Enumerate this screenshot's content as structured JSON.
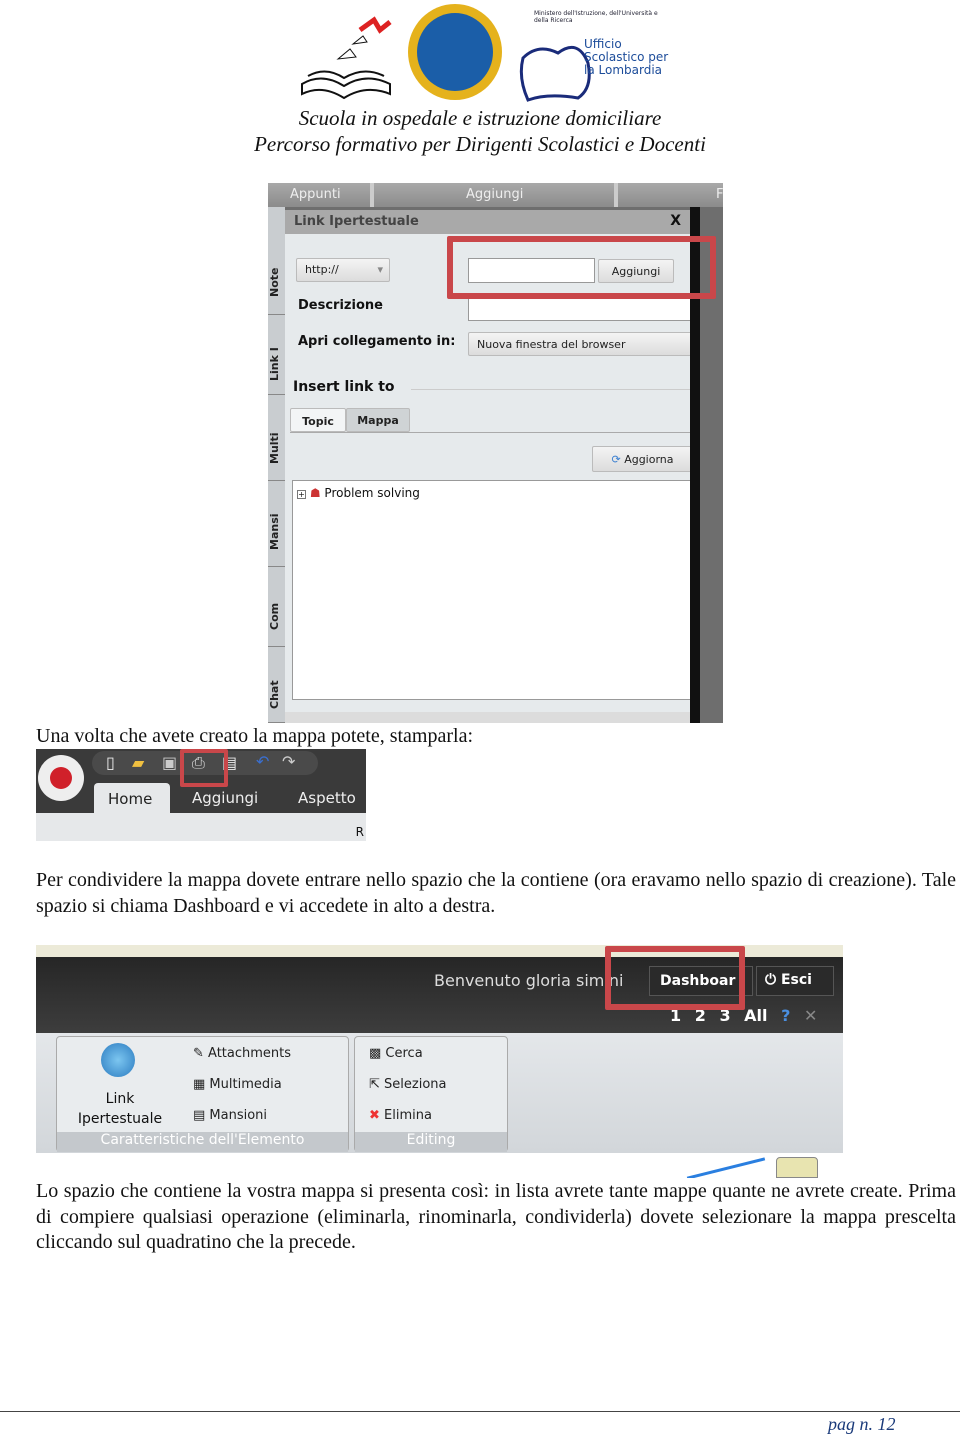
{
  "header": {
    "logo_right_ministry": "Ministero dell'Istruzione, dell'Università e della Ricerca",
    "logo_right_office": "Ufficio Scolastico per la Lombardia",
    "line1": "Scuola in ospedale e istruzione domiciliare",
    "line2": "Percorso formativo per Dirigenti Scolastici e Docenti"
  },
  "shot1": {
    "topbar": [
      "Appunti",
      "Aggiungi",
      "F"
    ],
    "vtabs": [
      "Note",
      "Link I",
      "Multi",
      "Mansi",
      "Com",
      "Chat"
    ],
    "dialog_title": "Link Ipertestuale",
    "close": "X",
    "protocol": "http://",
    "url_value": "",
    "add_button": "Aggiungi",
    "description_label": "Descrizione",
    "open_in_label": "Apri collegamento in:",
    "open_in_value": "Nuova finestra del browser",
    "insert_link_label": "Insert link to",
    "tabs": [
      "Topic",
      "Mappa"
    ],
    "refresh_button": "Aggiorna",
    "tree_item": "Problem solving"
  },
  "para1": "Una volta che avete creato la mappa potete, stamparla:",
  "shot2": {
    "tabs": [
      "Home",
      "Aggiungi",
      "Aspetto"
    ],
    "partial": "R"
  },
  "para2": "Per condividere la mappa dovete entrare nello spazio che la contiene (ora eravamo nello spazio di creazione). Tale spazio si chiama Dashboard e vi accedete in alto a destra.",
  "shot3": {
    "welcome": "Benvenuto gloria simini",
    "dashboard": "Dashboar",
    "logout": "Esci",
    "levels": [
      "1",
      "2",
      "3",
      "All"
    ],
    "link_button": "Link Ipertestuale",
    "attachments": "Attachments",
    "multimedia": "Multimedia",
    "mansioni": "Mansioni",
    "group1": "Caratteristiche dell'Elemento",
    "cerca": "Cerca",
    "seleziona": "Seleziona",
    "elimina": "Elimina",
    "group2": "Editing"
  },
  "para3": "Lo spazio che contiene la vostra mappa si presenta così: in lista avrete tante mappe quante ne avrete create. Prima di compiere qualsiasi operazione (eliminarla, rinominarla, condividerla) dovete selezionare la mappa prescelta cliccando sul quadratino che la precede.",
  "footer": {
    "page": "pag n. 12"
  }
}
